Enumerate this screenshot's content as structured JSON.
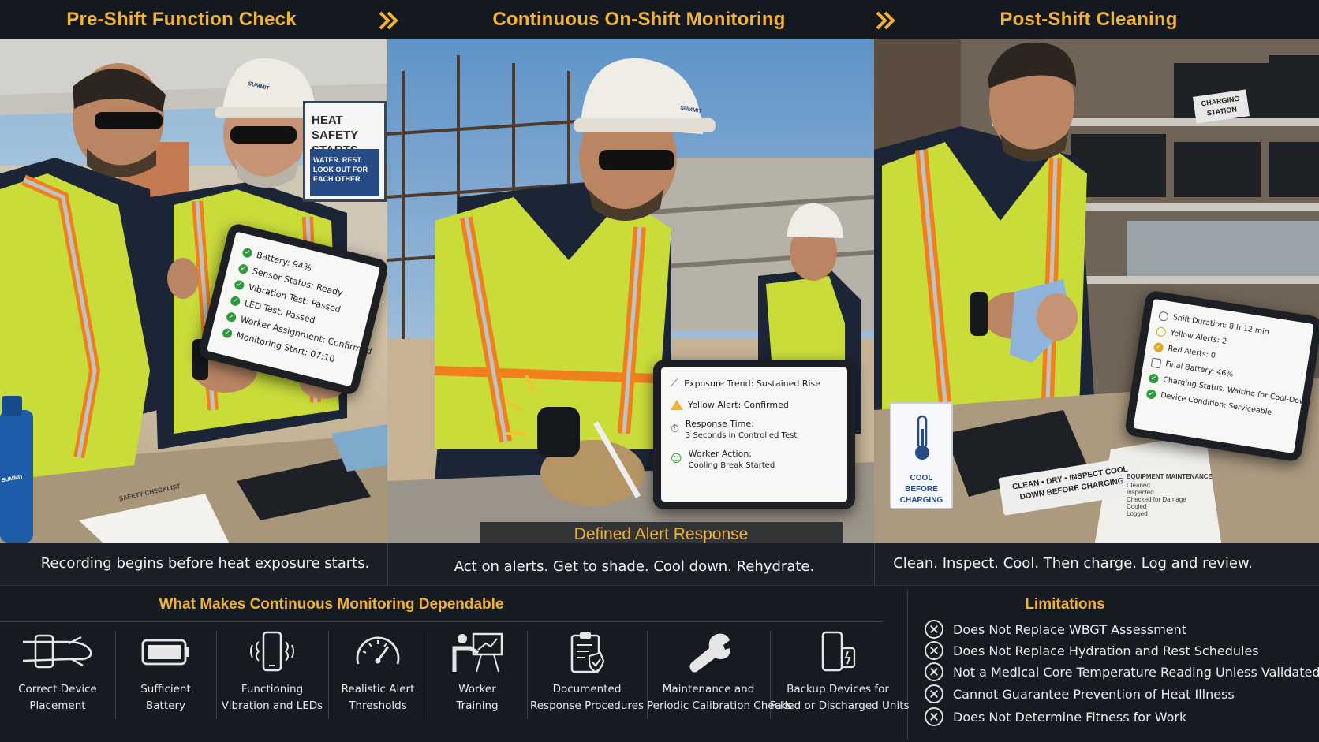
{
  "header": {
    "phase1": "Pre-Shift Function Check",
    "phase2": "Continuous On-Shift Monitoring",
    "phase3": "Post-Shift Cleaning"
  },
  "panel1": {
    "caption": "Recording begins before heat exposure starts.",
    "sign_title": "HEAT SAFETY STARTS HERE",
    "sign_sub": "WATER. REST. LOOK OUT FOR EACH OTHER.",
    "helmet_brand": "SUMMIT",
    "bottle_brand": "SUMMIT",
    "clipboard_title": "SAFETY CHECKLIST",
    "tablet": [
      "Battery: 94%",
      "Sensor Status: Ready",
      "Vibration Test: Passed",
      "LED Test: Passed",
      "Worker Assignment: Confirmed",
      "Monitoring Start: 07:10"
    ]
  },
  "panel2": {
    "tag": "Defined Alert Response",
    "caption": "Act on alerts. Get to shade. Cool down. Rehydrate.",
    "helmet_brand": "SUMMIT",
    "tablet": {
      "line1": "Exposure Trend: Sustained Rise",
      "line2": "Yellow Alert: Confirmed",
      "line3a": "Response Time:",
      "line3b": "3 Seconds in Controlled Test",
      "line4a": "Worker Action:",
      "line4b": "Cooling Break Started"
    }
  },
  "panel3": {
    "caption": "Clean. Inspect. Cool. Then charge. Log and review.",
    "station_label": "CHARGING STATION",
    "cool_sign": "COOL BEFORE CHARGING",
    "charger_label": "CLEAN • DRY • INSPECT COOL DOWN BEFORE CHARGING",
    "clipboard_title": "EQUIPMENT MAINTENANCE",
    "clipboard_items": [
      "Cleaned",
      "Inspected",
      "Checked for Damage",
      "Cooled",
      "Logged"
    ],
    "tablet": [
      "Shift Duration: 8 h 12 min",
      "Yellow Alerts: 2",
      "Red Alerts: 0",
      "Final Battery: 46%",
      "Charging Status: Waiting for Cool-Down",
      "Device Condition: Serviceable"
    ]
  },
  "dependable": {
    "title": "What Makes Continuous Monitoring Dependable",
    "features": [
      {
        "l1": "Correct Device",
        "l2": "Placement",
        "icon": "wrist-device-icon"
      },
      {
        "l1": "Sufficient",
        "l2": "Battery",
        "icon": "battery-icon"
      },
      {
        "l1": "Functioning",
        "l2": "Vibration and LEDs",
        "icon": "vibrating-phone-icon"
      },
      {
        "l1": "Realistic Alert",
        "l2": "Thresholds",
        "icon": "gauge-icon"
      },
      {
        "l1": "Worker",
        "l2": "Training",
        "icon": "trainer-icon"
      },
      {
        "l1": "Documented",
        "l2": "Response Procedures",
        "icon": "clipboard-check-icon"
      },
      {
        "l1": "Maintenance and",
        "l2": "Periodic Calibration Checks",
        "icon": "wrench-icon"
      },
      {
        "l1": "Backup Devices for",
        "l2": "Failed or Discharged Units",
        "icon": "backup-devices-icon"
      }
    ]
  },
  "limitations": {
    "title": "Limitations",
    "items": [
      "Does Not Replace WBGT Assessment",
      "Does Not Replace Hydration and Rest Schedules",
      "Not a Medical Core Temperature Reading Unless Validated",
      "Cannot Guarantee Prevention of Heat Illness",
      "Does Not Determine Fitness for Work"
    ]
  },
  "colors": {
    "accent": "#f2b233",
    "background": "#12171d",
    "vest": "#c9dc3a",
    "vest_stripe": "#f07f1e",
    "shirt": "#1b2536",
    "ok": "#2d9a3e"
  }
}
